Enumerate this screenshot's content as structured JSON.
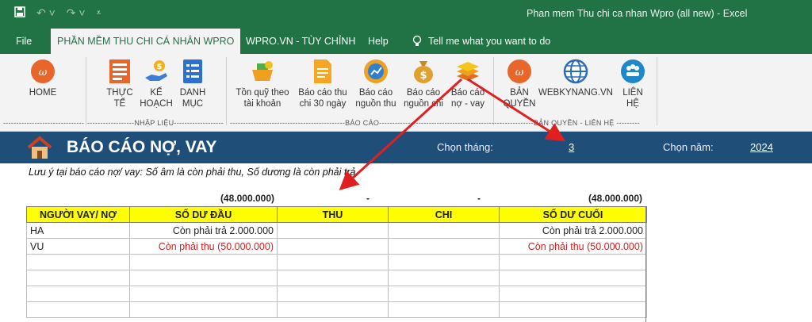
{
  "window": {
    "title": "Phan mem Thu chi ca nhan Wpro (all new)  -  Excel"
  },
  "tabs": [
    {
      "label": "File"
    },
    {
      "label": "PHẦN MỀM THU CHI CÁ NHÂN WPRO"
    },
    {
      "label": "WPRO.VN - TÙY CHỈNH"
    },
    {
      "label": "Help"
    }
  ],
  "tellme": "Tell me what you want to do",
  "ribbon": {
    "home": "HOME",
    "thucte": "THỰC\nTẾ",
    "kehoach": "KẾ\nHOẠCH",
    "danhmuc": "DANH\nMỤC",
    "tonquy": "Tồn quỹ theo\ntài khoản",
    "baocaothuchi": "Báo cáo thu\nchi 30 ngày",
    "nguonthu": "Báo cáo\nnguồn thu",
    "nguonchi": "Báo cáo\nnguồn chi",
    "novay": "Báo cáo\nnợ - vay",
    "banquyen": "BẢN\nQUYỀN",
    "webkynang": "WEBKYNANG.VN",
    "lienhe": "LIÊN\nHỆ",
    "group_nhaplieu": "------------------NHẬP LIỆU-------------------",
    "group_baocao": "--------------------------------------------BÁO CÁO-----------------------------------------------",
    "group_banquyen": "-------------BẢN QUYỀN - LIÊN HỆ ---------",
    "group_left": "-------------------------------"
  },
  "sheet": {
    "title": "BÁO CÁO NỢ, VAY",
    "month_label": "Chọn tháng:",
    "month_value": "3",
    "year_label": "Chọn năm:",
    "year_value": "2024",
    "note": "Lưu ý tại báo cáo nợ/ vay: Số âm là còn phải thu, Số dương là còn phải trả.",
    "totals": {
      "opening": "(48.000.000)",
      "thu": "-",
      "chi": "-",
      "closing": "(48.000.000)"
    },
    "headers": [
      "NGƯỜI VAY/ NỢ",
      "SỐ DƯ ĐẦU",
      "THU",
      "CHI",
      "SỐ DƯ CUỐI"
    ],
    "rows": [
      {
        "name": "HA",
        "opening": "Còn phải trả 2.000.000",
        "thu": "",
        "chi": "",
        "closing": "Còn phải trả 2.000.000",
        "color": "#222222"
      },
      {
        "name": "VU",
        "opening": "Còn phải thu (50.000.000)",
        "thu": "",
        "chi": "",
        "closing": "Còn phải thu (50.000.000)",
        "color": "#d02020"
      }
    ]
  },
  "colors": {
    "excel_green": "#217346",
    "banner_blue": "#1f4e79",
    "header_yellow": "#ffff00",
    "annotation_red": "#e02020"
  }
}
